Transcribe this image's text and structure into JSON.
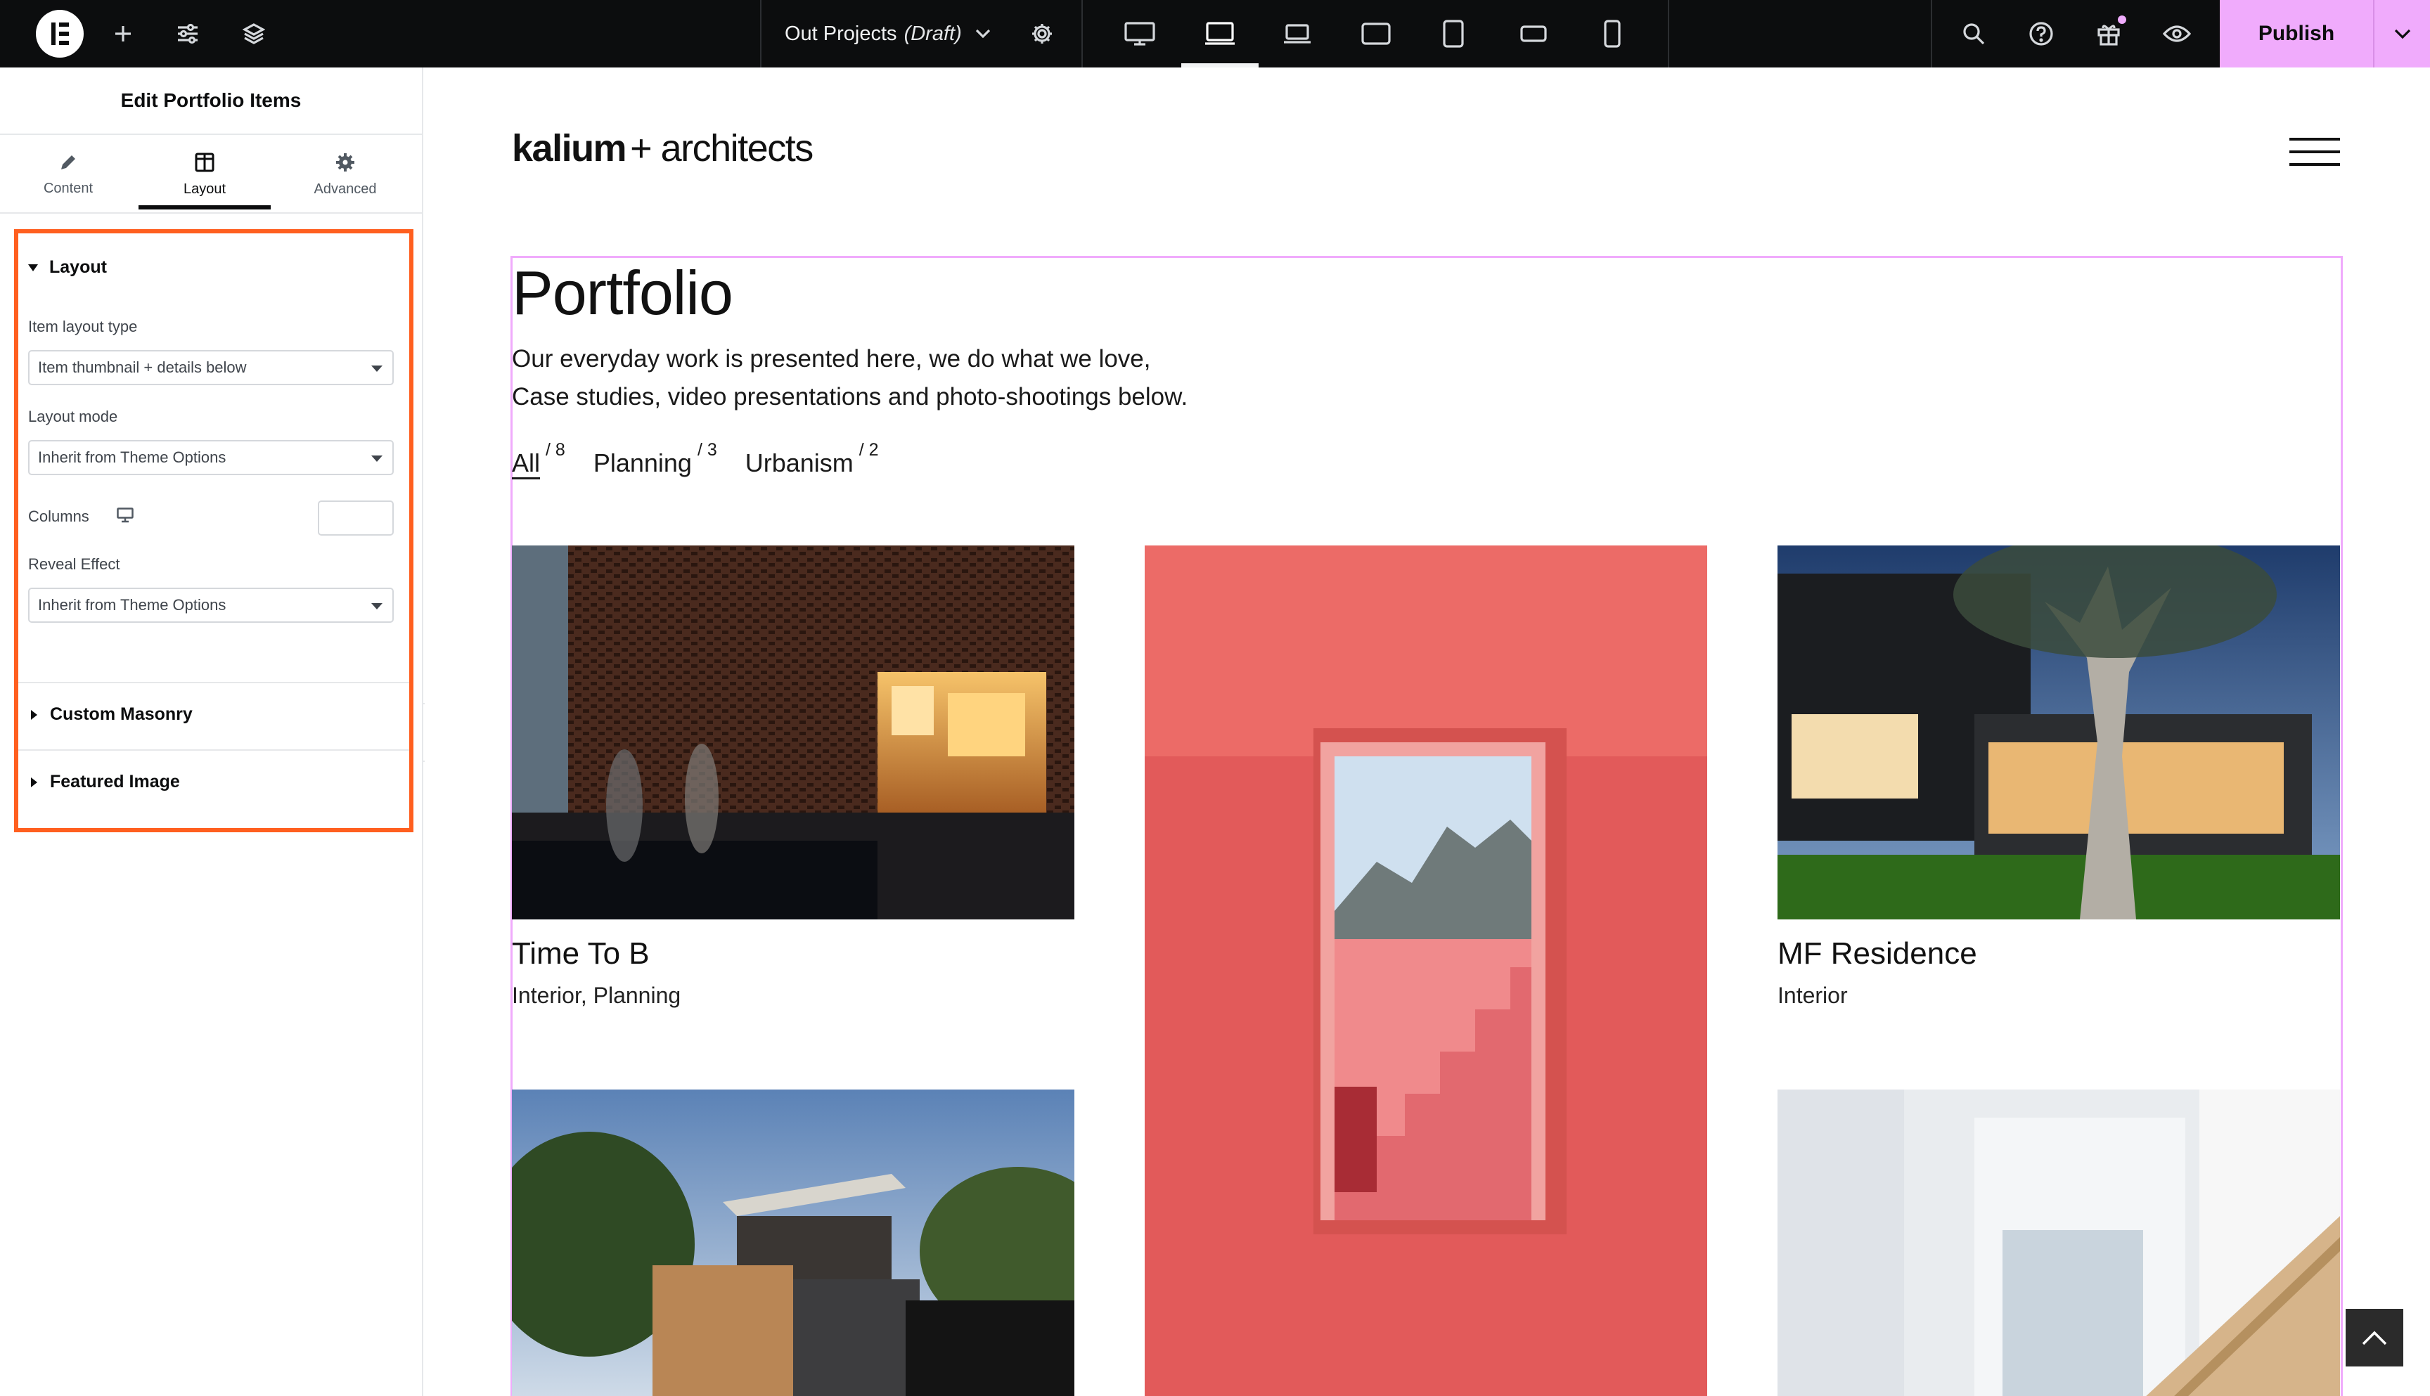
{
  "topbar": {
    "doc_name": "Out Projects",
    "doc_status": "(Draft)",
    "publish_label": "Publish",
    "icons": [
      "elementor-logo-icon",
      "add-icon",
      "settings-sliders-icon",
      "layers-icon",
      "chevron-down-icon",
      "gear-icon",
      "desktop-icon",
      "laptop-icon",
      "laptop-small-icon",
      "tablet-landscape-icon",
      "tablet-portrait-icon",
      "mobile-landscape-icon",
      "mobile-portrait-icon",
      "search-icon",
      "help-icon",
      "gift-icon",
      "preview-eye-icon"
    ],
    "accent_color": "#f0abfc"
  },
  "panel": {
    "title": "Edit Portfolio Items",
    "tabs": [
      {
        "label": "Content",
        "icon": "pencil-icon"
      },
      {
        "label": "Layout",
        "icon": "layout-columns-icon"
      },
      {
        "label": "Advanced",
        "icon": "gear-icon"
      }
    ],
    "active_tab": "Layout",
    "layout_section": {
      "title": "Layout",
      "item_layout_type_label": "Item layout type",
      "item_layout_type_value": "Item thumbnail + details below",
      "layout_mode_label": "Layout mode",
      "layout_mode_value": "Inherit from Theme Options",
      "columns_label": "Columns",
      "columns_value": "",
      "reveal_effect_label": "Reveal Effect",
      "reveal_effect_value": "Inherit from Theme Options"
    },
    "collapsed_sections": [
      "Custom Masonry",
      "Featured Image"
    ],
    "highlight_color": "#ff5f1f"
  },
  "preview": {
    "brand_bold": "kalium",
    "brand_light": "+ architects",
    "heading": "Portfolio",
    "description_line1": "Our everyday work is presented here, we do what we love,",
    "description_line2": "Case studies, video presentations and photo-shootings below.",
    "filters": [
      {
        "label": "All",
        "count": "/ 8"
      },
      {
        "label": "Planning",
        "count": "/ 3"
      },
      {
        "label": "Urbanism",
        "count": "/ 2"
      }
    ],
    "items": [
      {
        "title": "Time To B",
        "categories": "Interior, Planning"
      },
      {
        "title": "",
        "categories": ""
      },
      {
        "title": "MF Residence",
        "categories": "Interior"
      }
    ]
  }
}
